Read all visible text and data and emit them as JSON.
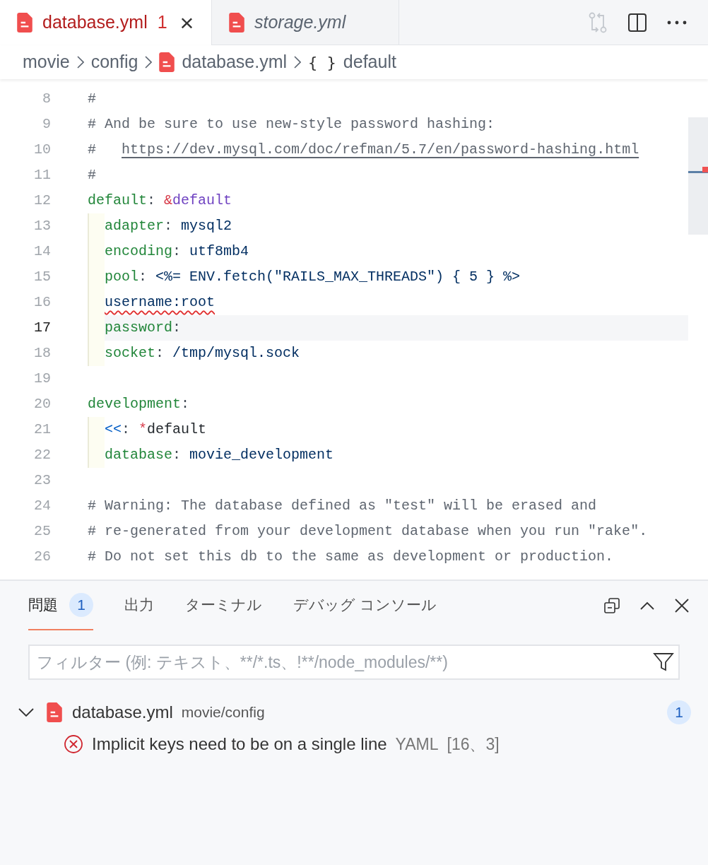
{
  "tabs": [
    {
      "label": "database.yml",
      "badge": "1",
      "selected": true,
      "has_error": true,
      "close": "×"
    },
    {
      "label": "storage.yml",
      "selected": false,
      "has_error": false
    }
  ],
  "breadcrumbs": [
    {
      "label": "movie"
    },
    {
      "label": "config"
    },
    {
      "label": "database.yml",
      "kind": "file"
    },
    {
      "label": "default",
      "symbol": "{ }",
      "kind": "symbol"
    }
  ],
  "editor": {
    "lines": [
      {
        "number": "8",
        "current": false,
        "error": false,
        "tokens": [
          {
            "kind": "comment",
            "text": "#"
          }
        ]
      },
      {
        "number": "9",
        "current": false,
        "error": false,
        "tokens": [
          {
            "kind": "comment",
            "text": "# And be sure to use new-style password hashing:"
          }
        ]
      },
      {
        "number": "10",
        "current": false,
        "error": false,
        "tokens": [
          {
            "kind": "comment",
            "text": "#   "
          },
          {
            "kind": "link",
            "text": "https://dev.mysql.com/doc/refman/5.7/en/password-hashing.html"
          }
        ]
      },
      {
        "number": "11",
        "current": false,
        "error": false,
        "tokens": [
          {
            "kind": "comment",
            "text": "#"
          }
        ]
      },
      {
        "number": "12",
        "current": false,
        "error": false,
        "tokens": [
          {
            "kind": "key",
            "text": "default"
          },
          {
            "kind": "punct",
            "text": ": "
          },
          {
            "kind": "anchor",
            "text": "&"
          },
          {
            "kind": "anchor_name",
            "text": "default"
          }
        ],
        "children": [
          {
            "number": "13",
            "current": false,
            "error": false,
            "tokens": [
              {
                "kind": "key",
                "text": "adapter"
              },
              {
                "kind": "punct",
                "text": ": "
              },
              {
                "kind": "value",
                "text": "mysql2"
              }
            ]
          },
          {
            "number": "14",
            "current": false,
            "error": false,
            "tokens": [
              {
                "kind": "key",
                "text": "encoding"
              },
              {
                "kind": "punct",
                "text": ": "
              },
              {
                "kind": "value",
                "text": "utf8mb4"
              }
            ]
          },
          {
            "number": "15",
            "current": false,
            "error": false,
            "tokens": [
              {
                "kind": "key",
                "text": "pool"
              },
              {
                "kind": "punct",
                "text": ": "
              },
              {
                "kind": "value",
                "text": "<%= ENV.fetch(\"RAILS_MAX_THREADS\") { 5 } %>"
              }
            ]
          },
          {
            "number": "16",
            "current": false,
            "error": true,
            "tokens": [
              {
                "kind": "value",
                "text": "username:root"
              }
            ]
          },
          {
            "number": "17",
            "current": true,
            "error": false,
            "tokens": [
              {
                "kind": "key",
                "text": "password"
              },
              {
                "kind": "punct",
                "text": ":"
              }
            ]
          },
          {
            "number": "18",
            "current": false,
            "error": false,
            "tokens": [
              {
                "kind": "key",
                "text": "socket"
              },
              {
                "kind": "punct",
                "text": ": "
              },
              {
                "kind": "value",
                "text": "/tmp/mysql.sock"
              }
            ]
          }
        ]
      },
      {
        "number": "19",
        "current": false
      },
      {
        "number": "20",
        "current": false,
        "error": false,
        "tokens": [
          {
            "kind": "key",
            "text": "development"
          },
          {
            "kind": "punct",
            "text": ":"
          }
        ],
        "children": [
          {
            "number": "21",
            "current": false,
            "error": false,
            "tokens": [
              {
                "kind": "merge",
                "text": "<<"
              },
              {
                "kind": "punct",
                "text": ": "
              },
              {
                "kind": "alias",
                "text": "*"
              },
              {
                "kind": "plain",
                "text": "default"
              }
            ]
          },
          {
            "number": "22",
            "current": false,
            "error": false,
            "tokens": [
              {
                "kind": "key",
                "text": "database"
              },
              {
                "kind": "punct",
                "text": ": "
              },
              {
                "kind": "value",
                "text": "movie_development"
              }
            ]
          }
        ]
      },
      {
        "number": "23",
        "current": false
      },
      {
        "number": "24",
        "current": false,
        "error": false,
        "tokens": [
          {
            "kind": "comment",
            "text": "# Warning: The database defined as \"test\" will be erased and"
          }
        ]
      },
      {
        "number": "25",
        "current": false,
        "error": false,
        "tokens": [
          {
            "kind": "comment",
            "text": "# re-generated from your development database when you run \"rake\"."
          }
        ]
      },
      {
        "number": "26",
        "current": false,
        "error": false,
        "tokens": [
          {
            "kind": "comment",
            "text": "# Do not set this db to the same as development or production."
          }
        ]
      }
    ]
  },
  "panel": {
    "tabs": [
      {
        "label": "問題",
        "badge": "1",
        "selected": true
      },
      {
        "label": "出力",
        "selected": false
      },
      {
        "label": "ターミナル",
        "selected": false
      },
      {
        "label": "デバッグ コンソール",
        "selected": false
      }
    ],
    "filter": {
      "placeholder": "フィルター (例: テキスト、**/*.ts、!**/node_modules/**)"
    },
    "problems": [
      {
        "file": "database.yml",
        "folder": "movie/config",
        "count": "1",
        "expanded": true,
        "items": [
          {
            "message": "Implicit keys need to be on a single line",
            "source": "YAML",
            "position": "[16、3]"
          }
        ]
      }
    ]
  }
}
